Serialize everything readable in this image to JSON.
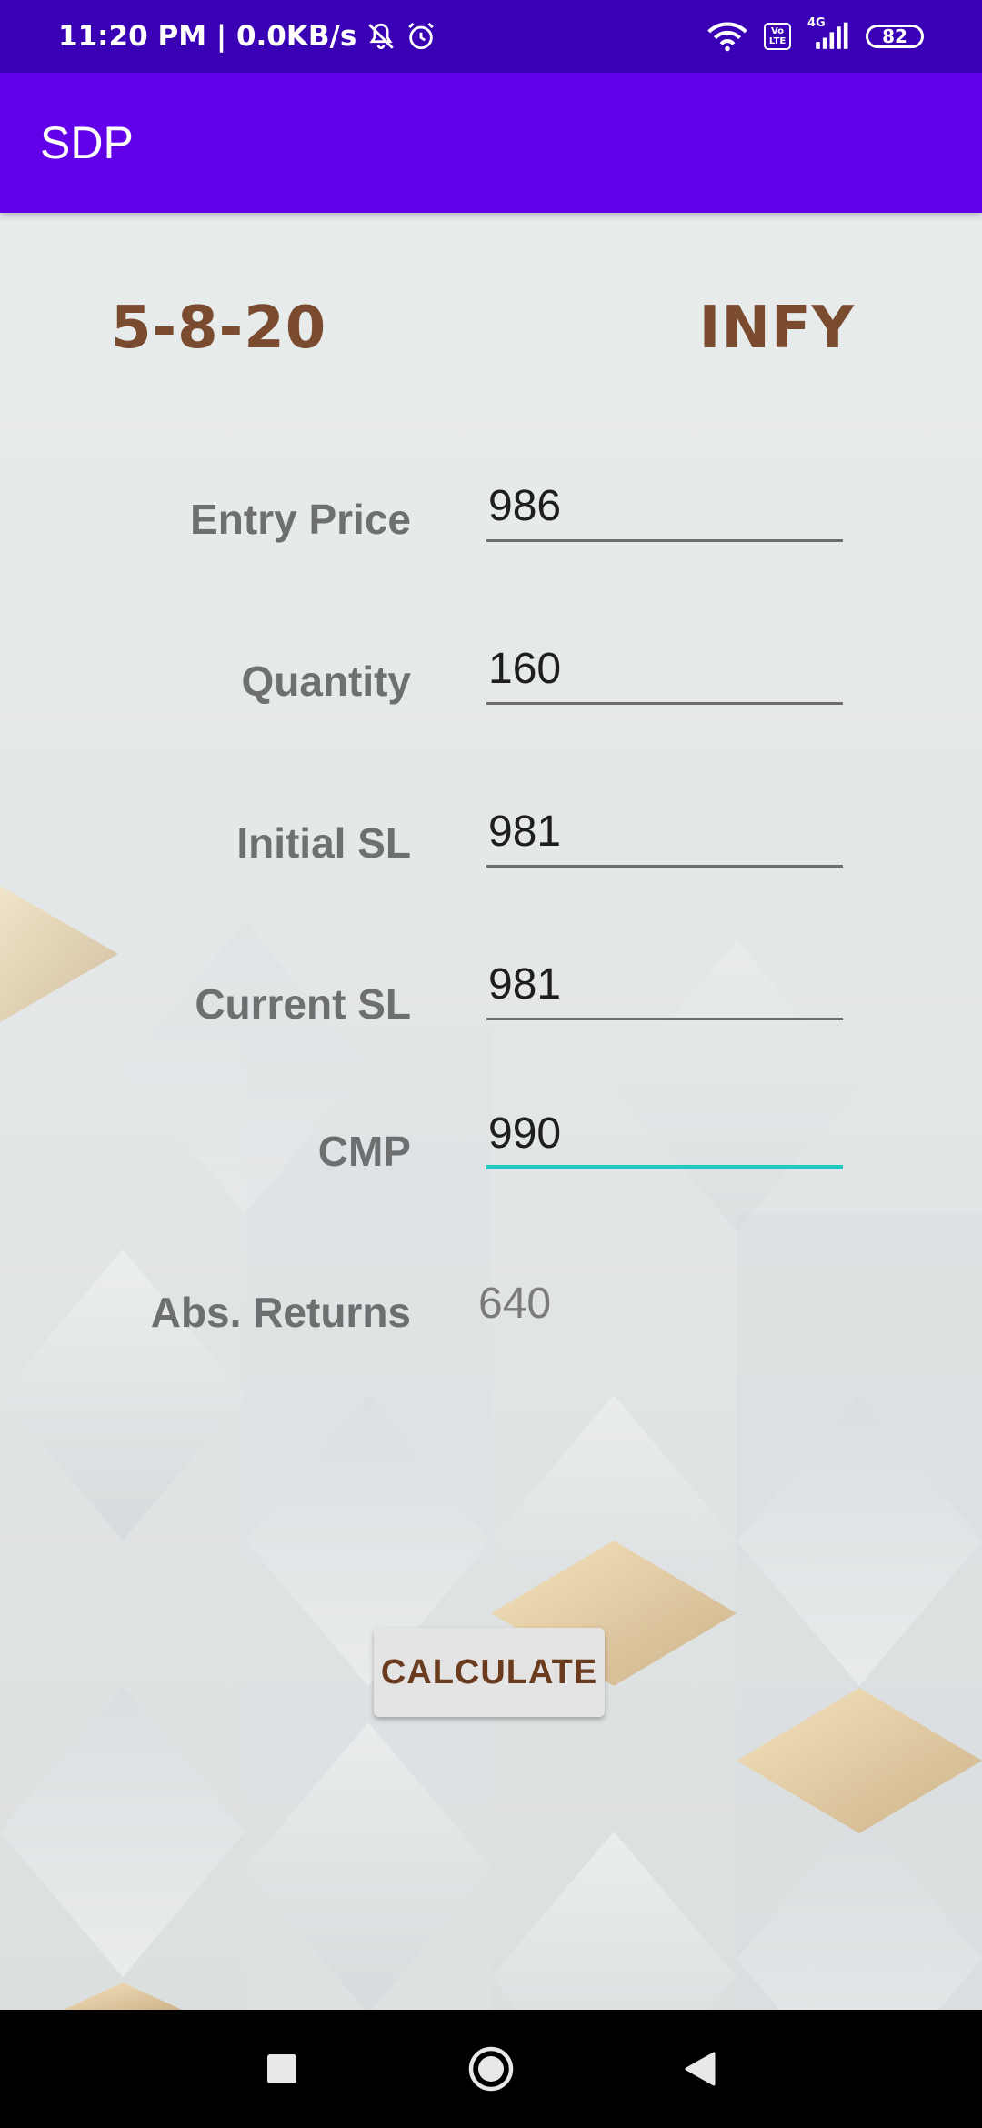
{
  "status_bar": {
    "time_and_speed": "11:20 PM | 0.0KB/s",
    "icons": [
      "mute-notification-icon",
      "alarm-icon",
      "wifi-icon",
      "volte-icon",
      "signal-4g-icon"
    ],
    "volte_label_top": "Vo",
    "volte_label_bottom": "LTE",
    "network_label": "4G",
    "battery": "82"
  },
  "app_bar": {
    "title": "SDP",
    "color": "#6200ea"
  },
  "header": {
    "date": "5-8-20",
    "symbol": "INFY",
    "color": "#7a4b2e"
  },
  "form": {
    "entry_price": {
      "label": "Entry Price",
      "value": "986"
    },
    "quantity": {
      "label": "Quantity",
      "value": "160"
    },
    "initial_sl": {
      "label": "Initial SL",
      "value": "981"
    },
    "current_sl": {
      "label": "Current SL",
      "value": "981"
    },
    "cmp": {
      "label": "CMP",
      "value": "990"
    },
    "abs_returns": {
      "label": "Abs. Returns",
      "value": "640"
    }
  },
  "focus_color": "#1fc9bd",
  "calculate_button": {
    "label": "CALCULATE"
  },
  "nav_bar": {
    "icons": [
      "recents-square-icon",
      "home-circle-icon",
      "back-triangle-icon"
    ]
  }
}
